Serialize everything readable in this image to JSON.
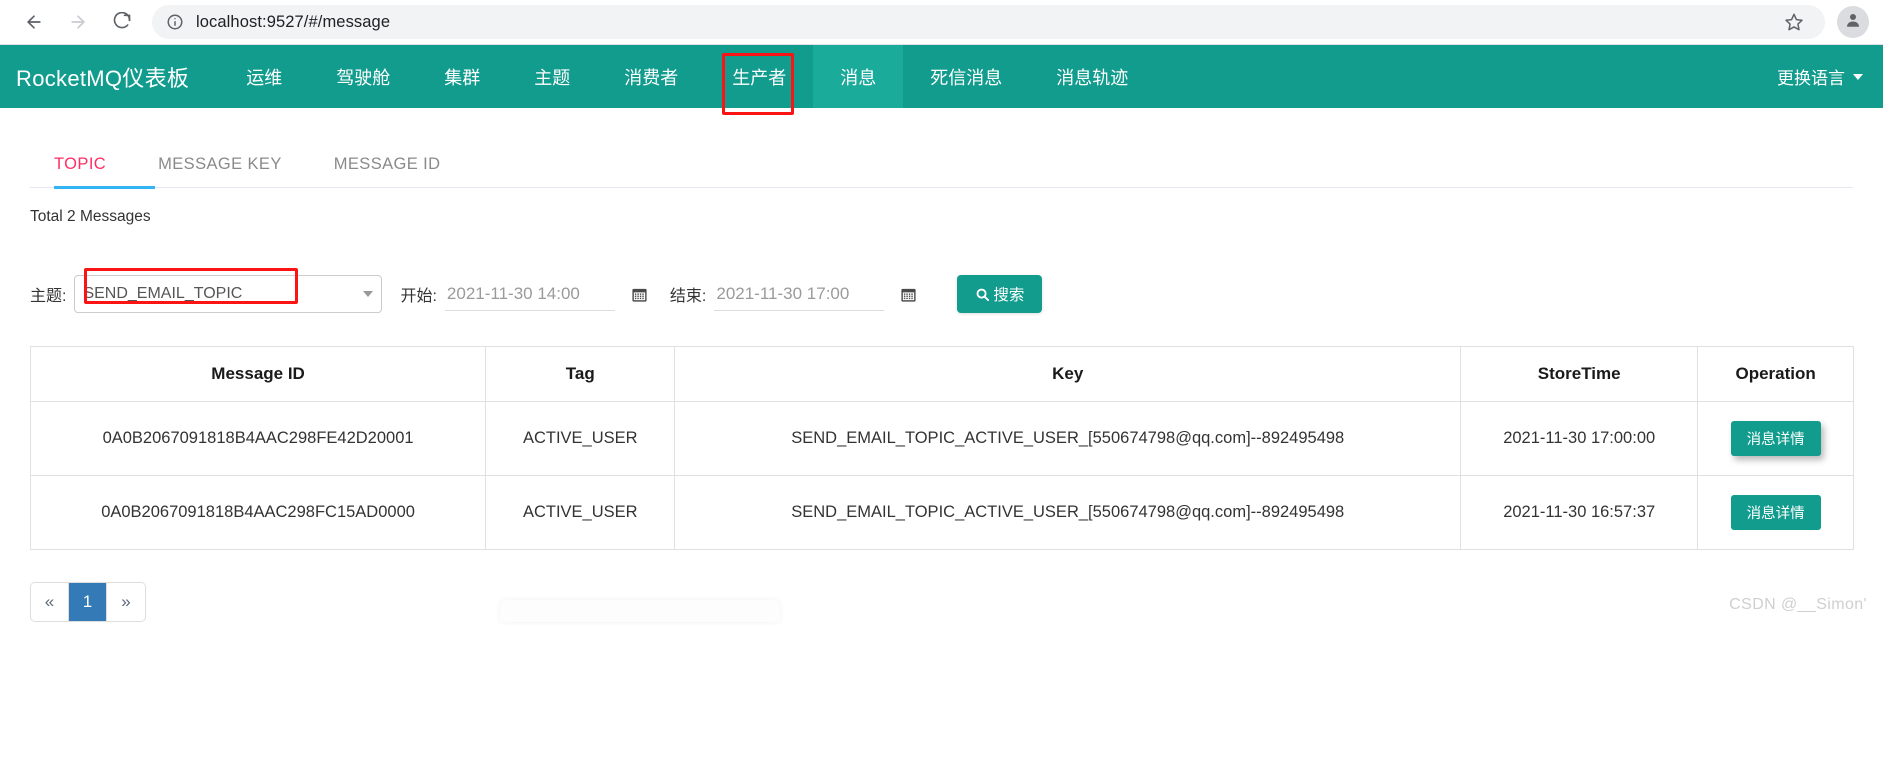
{
  "browser": {
    "back_icon": "arrow-left-icon",
    "forward_icon": "arrow-right-icon",
    "reload_icon": "reload-icon",
    "site_info_icon": "info-circle-icon",
    "url_host": "localhost:9527",
    "url_path": "/#/message",
    "url_full": "localhost:9527/#/message",
    "bookmark_icon": "star-icon",
    "profile_icon": "avatar-icon"
  },
  "app_nav": {
    "brand": "RocketMQ仪表板",
    "items": [
      {
        "label": "运维",
        "active": false
      },
      {
        "label": "驾驶舱",
        "active": false
      },
      {
        "label": "集群",
        "active": false
      },
      {
        "label": "主题",
        "active": false
      },
      {
        "label": "消费者",
        "active": false
      },
      {
        "label": "生产者",
        "active": false
      },
      {
        "label": "消息",
        "active": true
      },
      {
        "label": "死信消息",
        "active": false
      },
      {
        "label": "消息轨迹",
        "active": false
      }
    ],
    "language_label": "更换语言",
    "language_caret_icon": "chevron-down-icon",
    "accent_color": "#119c8e",
    "active_color": "#1aab9b",
    "annotation_color": "#fb1414"
  },
  "tabs": [
    {
      "label": "TOPIC",
      "active": true
    },
    {
      "label": "MESSAGE KEY",
      "active": false
    },
    {
      "label": "MESSAGE ID",
      "active": false
    }
  ],
  "tab_colors": {
    "active_text": "#ff2e63",
    "underline": "#33b5f5",
    "inactive_text": "#8a8a8a"
  },
  "total_text": "Total 2 Messages",
  "search": {
    "topic_label": "主题:",
    "topic_value": "SEND_EMAIL_TOPIC",
    "topic_caret_icon": "chevron-down-icon",
    "begin_label": "开始:",
    "begin_value": "2021-11-30 14:00",
    "begin_placeholder": "2021-11-30 14:00",
    "end_label": "结束:",
    "end_value": "2021-11-30 17:00",
    "end_placeholder": "2021-11-30 17:00",
    "calendar_icon": "calendar-icon",
    "search_icon": "magnifier-icon",
    "search_label": "搜索"
  },
  "table": {
    "headers": [
      "Message ID",
      "Tag",
      "Key",
      "StoreTime",
      "Operation"
    ],
    "rows": [
      {
        "message_id": "0A0B2067091818B4AAC298FE42D20001",
        "tag": "ACTIVE_USER",
        "key": "SEND_EMAIL_TOPIC_ACTIVE_USER_[550674798@qq.com]--892495498",
        "store_time": "2021-11-30 17:00:00",
        "operation_label": "消息详情"
      },
      {
        "message_id": "0A0B2067091818B4AAC298FC15AD0000",
        "tag": "ACTIVE_USER",
        "key": "SEND_EMAIL_TOPIC_ACTIVE_USER_[550674798@qq.com]--892495498",
        "store_time": "2021-11-30 16:57:37",
        "operation_label": "消息详情"
      }
    ]
  },
  "pagination": {
    "prev_label": "«",
    "pages": [
      "1"
    ],
    "next_label": "»",
    "active_page": "1",
    "active_color": "#337ab7"
  },
  "watermark": "CSDN @__Simon'"
}
